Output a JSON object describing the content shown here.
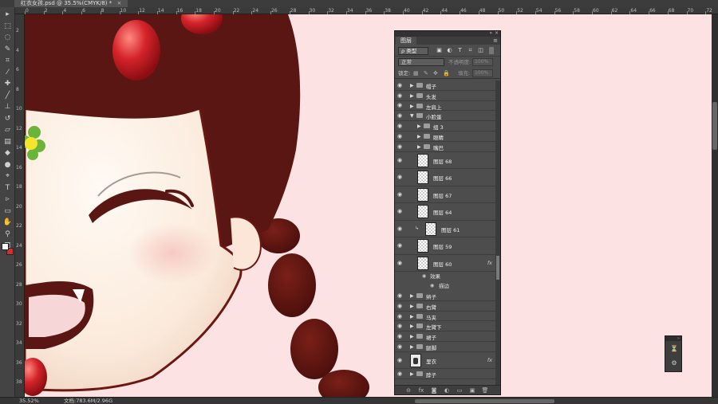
{
  "document": {
    "tab_title": "红衣女孩.psd @ 35.5%(CMYK/8) *",
    "close_glyph": "×"
  },
  "ruler": {
    "h_ticks": [
      "0",
      "2",
      "4",
      "6",
      "8",
      "10",
      "12",
      "14",
      "16",
      "18",
      "20",
      "22",
      "24",
      "26",
      "28",
      "30",
      "32",
      "34",
      "36",
      "38",
      "40",
      "42",
      "44",
      "46",
      "48",
      "50",
      "52",
      "54",
      "56",
      "58",
      "60",
      "62",
      "64",
      "66",
      "68",
      "70",
      "72"
    ],
    "v_ticks": [
      "2",
      "4",
      "6",
      "8",
      "10",
      "12",
      "14",
      "16",
      "18",
      "20",
      "22",
      "24",
      "26",
      "28",
      "30",
      "32",
      "34",
      "36",
      "38"
    ]
  },
  "tools": [
    {
      "name": "move-tool",
      "glyph": "▸"
    },
    {
      "name": "marquee-tool",
      "glyph": "⬚"
    },
    {
      "name": "lasso-tool",
      "glyph": "◌"
    },
    {
      "name": "quick-select-tool",
      "glyph": "✎"
    },
    {
      "name": "crop-tool",
      "glyph": "⌗"
    },
    {
      "name": "eyedropper-tool",
      "glyph": "⁄"
    },
    {
      "name": "healing-tool",
      "glyph": "✚"
    },
    {
      "name": "brush-tool",
      "glyph": "╱"
    },
    {
      "name": "stamp-tool",
      "glyph": "⊥"
    },
    {
      "name": "history-brush-tool",
      "glyph": "↺"
    },
    {
      "name": "eraser-tool",
      "glyph": "▱"
    },
    {
      "name": "gradient-tool",
      "glyph": "▤"
    },
    {
      "name": "blur-tool",
      "glyph": "◆"
    },
    {
      "name": "dodge-tool",
      "glyph": "●"
    },
    {
      "name": "pen-tool",
      "glyph": "⌖"
    },
    {
      "name": "type-tool",
      "glyph": "T"
    },
    {
      "name": "path-select-tool",
      "glyph": "▹"
    },
    {
      "name": "shape-tool",
      "glyph": "▭"
    },
    {
      "name": "hand-tool",
      "glyph": "✋"
    },
    {
      "name": "zoom-tool",
      "glyph": "⚲"
    },
    {
      "name": "default-colors",
      "glyph": "◩"
    }
  ],
  "panel": {
    "tab_label": "图层",
    "menu_glyph": "≡",
    "collapse_glyph": "»",
    "filter_kind": "ρ 类型",
    "filter_icons": [
      "▣",
      "◐",
      "T",
      "⌑",
      "◫"
    ],
    "blend_mode": "正常",
    "opacity_label": "不透明度:",
    "opacity_value": "100%",
    "lock_label": "锁定:",
    "lock_icons": [
      "▦",
      "✎",
      "✥",
      "🔒"
    ],
    "fill_label": "填充:",
    "fill_value": "100%",
    "bottom_icons": [
      "⊝",
      "fx",
      "◙",
      "◐",
      "▭",
      "▣",
      "🗑"
    ]
  },
  "layers": [
    {
      "type": "group",
      "name": "帽子",
      "indent": 0,
      "open": false
    },
    {
      "type": "group",
      "name": "头发",
      "indent": 0,
      "open": false
    },
    {
      "type": "group",
      "name": "左肩上",
      "indent": 0,
      "open": false
    },
    {
      "type": "group",
      "name": "小脸蛋",
      "indent": 0,
      "open": true
    },
    {
      "type": "group",
      "name": "组 3",
      "indent": 1,
      "open": false
    },
    {
      "type": "group",
      "name": "眼睛",
      "indent": 1,
      "open": false
    },
    {
      "type": "group",
      "name": "嘴巴",
      "indent": 1,
      "open": false
    },
    {
      "type": "layer",
      "name": "图层 68",
      "indent": 1
    },
    {
      "type": "layer",
      "name": "图层 66",
      "indent": 1
    },
    {
      "type": "layer",
      "name": "图层 67",
      "indent": 1
    },
    {
      "type": "layer",
      "name": "图层 64",
      "indent": 1
    },
    {
      "type": "layer",
      "name": "图层 61",
      "indent": 1,
      "clipped": true
    },
    {
      "type": "layer",
      "name": "图层 59",
      "indent": 1
    },
    {
      "type": "layer",
      "name": "图层 60",
      "indent": 1,
      "fx": true
    },
    {
      "type": "effect",
      "name": "效果"
    },
    {
      "type": "effect",
      "name": "描边",
      "sub": true
    },
    {
      "type": "group",
      "name": "辫子",
      "indent": 0,
      "open": false
    },
    {
      "type": "group",
      "name": "右臂",
      "indent": 0,
      "open": false
    },
    {
      "type": "group",
      "name": "马夹",
      "indent": 0,
      "open": false
    },
    {
      "type": "group",
      "name": "左臂下",
      "indent": 0,
      "open": false
    },
    {
      "type": "group",
      "name": "裙子",
      "indent": 0,
      "open": false
    },
    {
      "type": "group",
      "name": "腿脚",
      "indent": 0,
      "open": false
    },
    {
      "type": "layer",
      "name": "里衣",
      "indent": 0,
      "fx": true,
      "dark": true
    },
    {
      "type": "group",
      "name": "脖子",
      "indent": 0,
      "open": false
    }
  ],
  "status": {
    "zoom": "35.52%",
    "doc_info": "文档:783.6M/2.96G"
  },
  "colors": {
    "canvas_bg": "#fce2e2",
    "hair": "#5a1612",
    "skin": "#fdf3ea",
    "berry": "#c81f1f"
  }
}
